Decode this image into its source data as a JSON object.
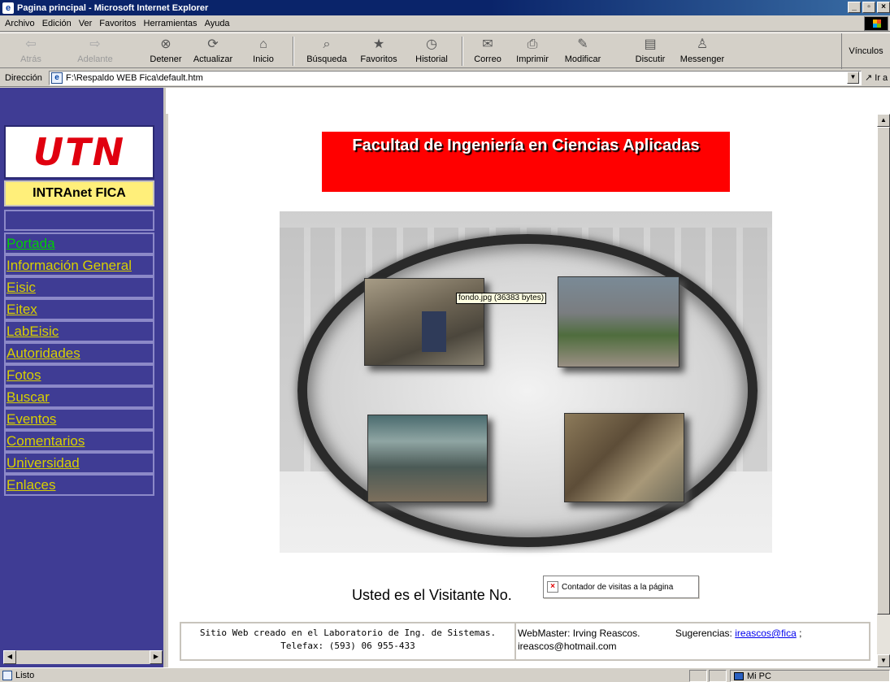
{
  "window": {
    "title": "Pagina principal - Microsoft Internet Explorer"
  },
  "menu": [
    "Archivo",
    "Edición",
    "Ver",
    "Favoritos",
    "Herramientas",
    "Ayuda"
  ],
  "toolbar": {
    "back": "Atrás",
    "forward": "Adelante",
    "stop": "Detener",
    "refresh": "Actualizar",
    "home": "Inicio",
    "search": "Búsqueda",
    "favorites": "Favoritos",
    "history": "Historial",
    "mail": "Correo",
    "print": "Imprimir",
    "edit": "Modificar",
    "discuss": "Discutir",
    "messenger": "Messenger",
    "links": "Vínculos"
  },
  "address": {
    "label": "Dirección",
    "value": "F:\\Respaldo WEB Fica\\default.htm",
    "go": "Ir a"
  },
  "sidebar": {
    "logo": "UTN",
    "subtitle": "INTRAnet FICA",
    "links": [
      {
        "label": "Portada",
        "visited": true
      },
      {
        "label": "Información General",
        "visited": false
      },
      {
        "label": "Eisic",
        "visited": false
      },
      {
        "label": "Eitex",
        "visited": false
      },
      {
        "label": "LabEisic",
        "visited": false
      },
      {
        "label": "Autoridades",
        "visited": false
      },
      {
        "label": "Fotos",
        "visited": false
      },
      {
        "label": "Buscar",
        "visited": false
      },
      {
        "label": "Eventos",
        "visited": false
      },
      {
        "label": "Comentarios",
        "visited": false
      },
      {
        "label": "Universidad",
        "visited": false
      },
      {
        "label": "Enlaces",
        "visited": false
      }
    ]
  },
  "main": {
    "banner": "Facultad de Ingeniería en Ciencias Aplicadas",
    "tooltip": "fondo.jpg (36383 bytes)",
    "visitor_text": "Usted es el Visitante No.",
    "counter_alt": "Contador de visitas a la página",
    "footer": {
      "line1": "Sitio Web creado en el Laboratorio de Ing. de Sistemas.",
      "line2": "Telefax: (593) 06 955-433",
      "webmaster": "WebMaster: Irving Reascos.",
      "suggest_label": "Sugerencias:",
      "suggest_link": "ireascos@fica",
      "suggest_sep": ";",
      "email2": "ireascos@hotmail.com"
    }
  },
  "status": {
    "text": "Listo",
    "zone": "Mi PC"
  }
}
